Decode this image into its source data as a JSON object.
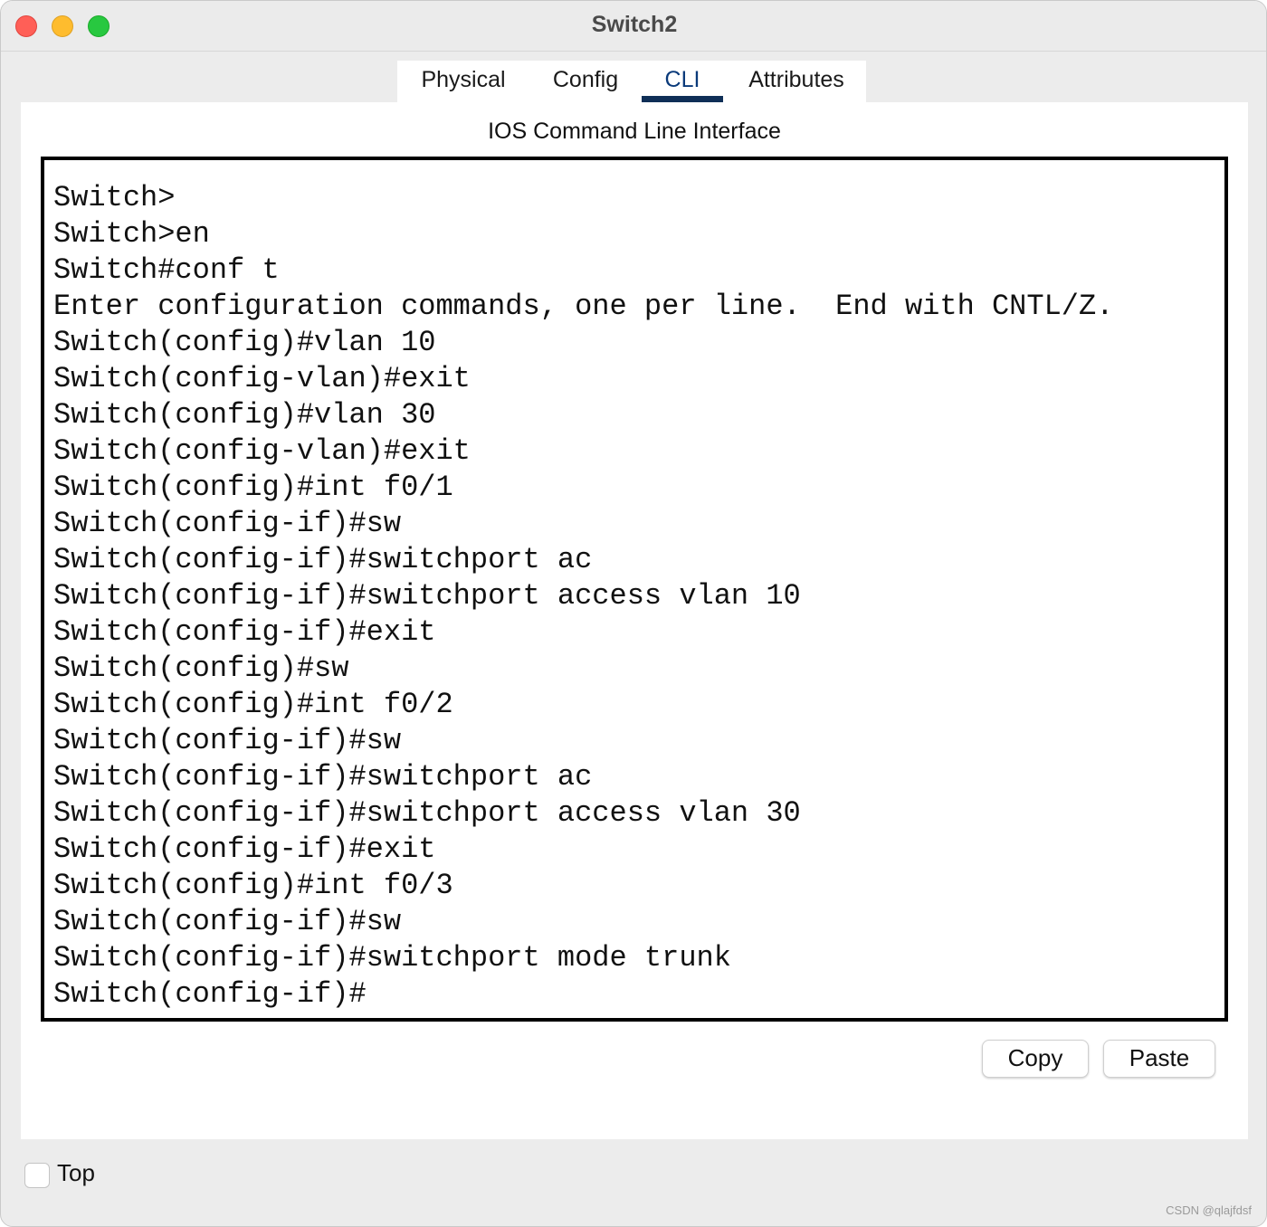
{
  "window": {
    "title": "Switch2"
  },
  "tabs": [
    {
      "label": "Physical",
      "active": false
    },
    {
      "label": "Config",
      "active": false
    },
    {
      "label": "CLI",
      "active": true
    },
    {
      "label": "Attributes",
      "active": false
    }
  ],
  "panel": {
    "heading": "IOS Command Line Interface"
  },
  "terminal": {
    "lines": [
      "Switch>",
      "Switch>en",
      "Switch#conf t",
      "Enter configuration commands, one per line.  End with CNTL/Z.",
      "Switch(config)#vlan 10",
      "Switch(config-vlan)#exit",
      "Switch(config)#vlan 30",
      "Switch(config-vlan)#exit",
      "Switch(config)#int f0/1",
      "Switch(config-if)#sw",
      "Switch(config-if)#switchport ac",
      "Switch(config-if)#switchport access vlan 10",
      "Switch(config-if)#exit",
      "Switch(config)#sw",
      "Switch(config)#int f0/2",
      "Switch(config-if)#sw",
      "Switch(config-if)#switchport ac",
      "Switch(config-if)#switchport access vlan 30",
      "Switch(config-if)#exit",
      "Switch(config)#int f0/3",
      "Switch(config-if)#sw",
      "Switch(config-if)#switchport mode trunk",
      "Switch(config-if)#"
    ]
  },
  "buttons": {
    "copy_label": "Copy",
    "paste_label": "Paste"
  },
  "footer": {
    "top_label": "Top",
    "top_checked": false
  },
  "watermark": "CSDN @qlajfdsf",
  "colors": {
    "close": "#ff5f57",
    "minimize": "#febc2e",
    "maximize": "#28c840",
    "active_tab_underline": "#0f2f57"
  }
}
